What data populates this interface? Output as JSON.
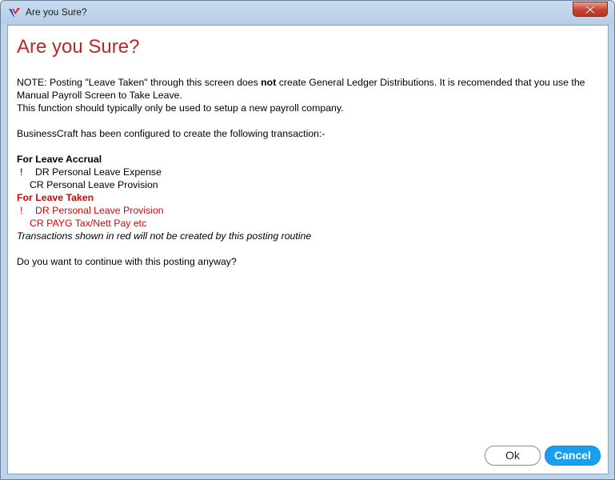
{
  "window": {
    "title": "Are you Sure?"
  },
  "dialog": {
    "heading": "Are you Sure?",
    "note_prefix": "NOTE: Posting \"Leave Taken\" through this screen does ",
    "note_bold": "not",
    "note_suffix": " create General Ledger Distributions. It is recomended that you use the Manual Payroll Screen to Take Leave.",
    "note_line2": "This function should typically only be used to setup a new payroll company.",
    "config_line": "BusinessCraft has been configured to create the following transaction:-",
    "accrual": {
      "heading": "For Leave Accrual",
      "mark": "!",
      "dr_line": "DR Personal Leave Expense",
      "cr_line": "CR Personal Leave Provision"
    },
    "taken": {
      "heading": "For Leave Taken",
      "mark": "!",
      "dr_line": "DR Personal Leave Provision",
      "cr_line": "CR PAYG Tax/Nett Pay etc"
    },
    "red_note": "Transactions shown in red will not be created by this posting routine",
    "question": "Do you want to continue with this posting anyway?"
  },
  "buttons": {
    "ok_label": "Ok",
    "cancel_label": "Cancel"
  },
  "colors": {
    "heading": "#b22a2a",
    "red_text": "#e00000",
    "cancel_bg": "#1a9ff0"
  }
}
